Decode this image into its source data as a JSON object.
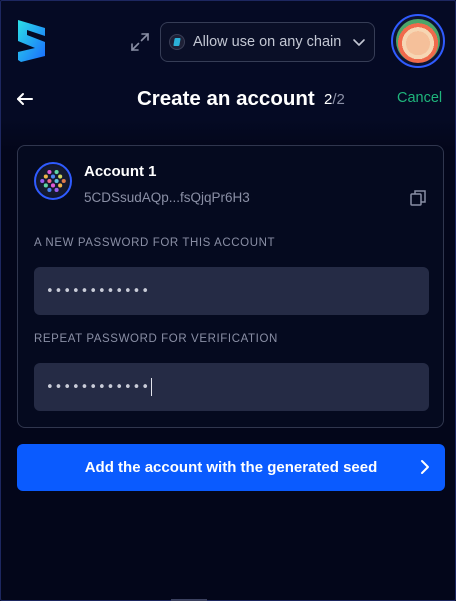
{
  "topbar": {
    "logo_icon": "subwallet-logo",
    "expand_icon": "expand-arrows-icon",
    "chain_select": {
      "label": "Allow use on any chain",
      "icon": "chain-icon",
      "chevron": "chevron-down-icon"
    },
    "avatar_icon": "account-avatar"
  },
  "header": {
    "back_icon": "arrow-left-icon",
    "title": "Create an account",
    "step_current": "2",
    "step_sep": "/",
    "step_total": "2",
    "cancel_label": "Cancel"
  },
  "account": {
    "name": "Account 1",
    "address": "5CDSsudAQp...fsQjqPr6H3",
    "copy_icon": "copy-icon"
  },
  "form": {
    "password_label": "A NEW PASSWORD FOR THIS ACCOUNT",
    "password_value": "••••••••••••",
    "repeat_label": "REPEAT PASSWORD FOR VERIFICATION",
    "repeat_value": "••••••••••••"
  },
  "actions": {
    "primary_label": "Add the account with the generated seed",
    "primary_icon": "chevron-right-icon"
  },
  "colors": {
    "accent": "#0a5bff",
    "cancel": "#1fb57c",
    "background": "#03061a",
    "field": "#252b45"
  }
}
